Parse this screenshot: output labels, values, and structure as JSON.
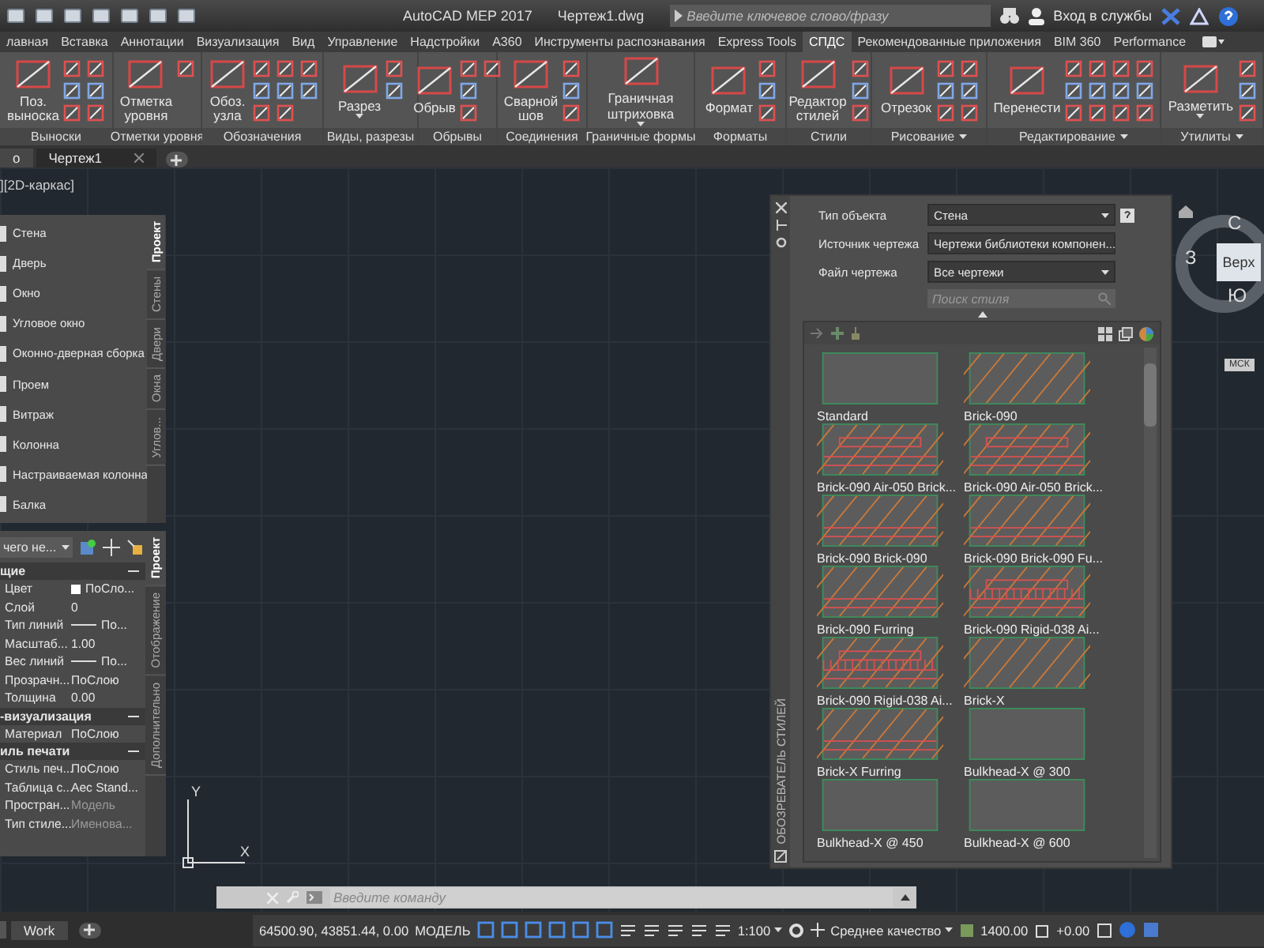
{
  "title_bar": {
    "app": "AutoCAD MEP 2017",
    "file": "Чертеж1.dwg",
    "search": {
      "placeholder": "Введите ключевое слово/фразу"
    },
    "sign_in": "Вход в службы"
  },
  "ribbon": {
    "tabs": [
      {
        "label": "лавная",
        "selected": false
      },
      {
        "label": "Вставка",
        "selected": false
      },
      {
        "label": "Аннотации",
        "selected": false
      },
      {
        "label": "Визуализация",
        "selected": false
      },
      {
        "label": "Вид",
        "selected": false
      },
      {
        "label": "Управление",
        "selected": false
      },
      {
        "label": "Надстройки",
        "selected": false
      },
      {
        "label": "А360",
        "selected": false
      },
      {
        "label": "Инструменты распознавания",
        "selected": false
      },
      {
        "label": "Express Tools",
        "selected": false
      },
      {
        "label": "СПДС",
        "selected": true
      },
      {
        "label": "Рекомендованные приложения",
        "selected": false
      },
      {
        "label": "BIM 360",
        "selected": false
      },
      {
        "label": "Performance",
        "selected": false
      }
    ],
    "panels": [
      {
        "title": "Выноски",
        "expandable": false,
        "buttons": [
          {
            "label": "Поз.\nвыноска",
            "dropdown": false
          }
        ]
      },
      {
        "title": "Отметки уровня",
        "expandable": false,
        "buttons": [
          {
            "label": "Отметка\nуровня",
            "dropdown": false
          }
        ]
      },
      {
        "title": "Обозначения",
        "expandable": false,
        "buttons": [
          {
            "label": "Обоз.\nузла",
            "dropdown": false
          }
        ]
      },
      {
        "title": "Виды, разрезы",
        "expandable": false,
        "buttons": [
          {
            "label": "Разрез",
            "dropdown": true
          }
        ]
      },
      {
        "title": "Обрывы",
        "expandable": false,
        "buttons": [
          {
            "label": "Обрыв",
            "dropdown": false
          }
        ]
      },
      {
        "title": "Соединения",
        "expandable": false,
        "buttons": [
          {
            "label": "Сварной\nшов",
            "dropdown": false
          }
        ]
      },
      {
        "title": "Граничные формы",
        "expandable": false,
        "buttons": [
          {
            "label": "Граничная\nштриховка",
            "dropdown": true
          }
        ]
      },
      {
        "title": "Форматы",
        "expandable": false,
        "buttons": [
          {
            "label": "Формат",
            "dropdown": false
          }
        ]
      },
      {
        "title": "Стили",
        "expandable": false,
        "buttons": [
          {
            "label": "Редактор\nстилей",
            "dropdown": false
          }
        ]
      },
      {
        "title": "Рисование",
        "expandable": true,
        "buttons": [
          {
            "label": "Отрезок",
            "dropdown": false
          }
        ]
      },
      {
        "title": "Редактирование",
        "expandable": true,
        "buttons": [
          {
            "label": "Перенести",
            "dropdown": false
          }
        ]
      },
      {
        "title": "Утилиты",
        "expandable": true,
        "buttons": [
          {
            "label": "Разметить",
            "dropdown": true
          }
        ]
      }
    ]
  },
  "doc_tabs": [
    {
      "label": "о",
      "selected": false
    },
    {
      "label": "Чертеж1",
      "selected": true
    }
  ],
  "viewport_label": "][2D-каркас]",
  "tool_palette": {
    "items": [
      {
        "label": "Стена"
      },
      {
        "label": "Дверь"
      },
      {
        "label": "Окно"
      },
      {
        "label": "Угловое окно"
      },
      {
        "label": "Оконно-дверная сборка"
      },
      {
        "label": "Проем"
      },
      {
        "label": "Витраж"
      },
      {
        "label": "Колонна"
      },
      {
        "label": "Настраиваемая колонна"
      },
      {
        "label": "Балка"
      }
    ],
    "tabs": [
      {
        "label": "Проект",
        "selected": true
      },
      {
        "label": "Стены",
        "selected": false
      },
      {
        "label": "Двери",
        "selected": false
      },
      {
        "label": "Окна",
        "selected": false
      },
      {
        "label": "Углов...",
        "selected": false
      }
    ]
  },
  "properties": {
    "selector": "чего не...",
    "sections": [
      {
        "title": "щие",
        "expanded": true,
        "rows": [
          {
            "name": "Цвет",
            "value": "ПоСло...",
            "kind": "color",
            "disabled": false
          },
          {
            "name": "Слой",
            "value": "0",
            "kind": "text",
            "disabled": false
          },
          {
            "name": "Тип линий",
            "value": "По...",
            "kind": "line",
            "disabled": false
          },
          {
            "name": "Масштаб...",
            "value": "1.00",
            "kind": "text",
            "disabled": false
          },
          {
            "name": "Вес линий",
            "value": "По...",
            "kind": "line",
            "disabled": false
          },
          {
            "name": "Прозрачн...",
            "value": "ПоСлою",
            "kind": "text",
            "disabled": false
          },
          {
            "name": "Толщина",
            "value": "0.00",
            "kind": "text",
            "disabled": false
          }
        ]
      },
      {
        "title": "-визуализация",
        "expanded": true,
        "rows": [
          {
            "name": "Материал",
            "value": "ПоСлою",
            "kind": "text",
            "disabled": false
          }
        ]
      },
      {
        "title": "иль печати",
        "expanded": true,
        "rows": [
          {
            "name": "Стиль печ...",
            "value": "ПоСлою",
            "kind": "text",
            "disabled": false
          },
          {
            "name": "Таблица с...",
            "value": "Aec Stand...",
            "kind": "text",
            "disabled": false
          },
          {
            "name": "Простран...",
            "value": "Модель",
            "kind": "text",
            "disabled": true
          },
          {
            "name": "Тип стиле...",
            "value": "Именова...",
            "kind": "text",
            "disabled": true
          }
        ]
      }
    ],
    "tabs": [
      {
        "label": "Проект",
        "selected": true
      },
      {
        "label": "Отображение",
        "selected": false
      },
      {
        "label": "Дополнительно",
        "selected": false
      }
    ]
  },
  "style_browser": {
    "title": "ОБОЗРЕВАТЕЛЬ СТИЛЕЙ",
    "fields": [
      {
        "label": "Тип объекта",
        "value": "Стена"
      },
      {
        "label": "Источник чертежа",
        "value": "Чертежи библиотеки компонен..."
      },
      {
        "label": "Файл чертежа",
        "value": "Все чертежи"
      }
    ],
    "search": {
      "placeholder": "Поиск стиля"
    },
    "styles": [
      {
        "name": "Standard",
        "kind": "empty"
      },
      {
        "name": "Brick-090",
        "kind": "hatch"
      },
      {
        "name": "Brick-090 Air-050 Brick...",
        "kind": "band"
      },
      {
        "name": "Brick-090 Air-050 Brick...",
        "kind": "band"
      },
      {
        "name": "Brick-090 Brick-090",
        "kind": "lines"
      },
      {
        "name": "Brick-090 Brick-090 Fu...",
        "kind": "lines"
      },
      {
        "name": "Brick-090 Furring",
        "kind": "lines"
      },
      {
        "name": "Brick-090 Rigid-038 Ai...",
        "kind": "rigid"
      },
      {
        "name": "Brick-090 Rigid-038 Ai...",
        "kind": "rigid"
      },
      {
        "name": "Brick-X",
        "kind": "hatch"
      },
      {
        "name": "Brick-X Furring",
        "kind": "lines"
      },
      {
        "name": "Bulkhead-X @ 300",
        "kind": "empty"
      },
      {
        "name": "Bulkhead-X @ 450",
        "kind": "empty"
      },
      {
        "name": "Bulkhead-X @ 600",
        "kind": "empty"
      }
    ]
  },
  "view_cube": {
    "north": "С",
    "west": "З",
    "face": "Верх",
    "south": "Ю",
    "ucs": "МСК"
  },
  "ucs_icon": {
    "x": "X",
    "y": "Y"
  },
  "command_line": {
    "placeholder": "Введите команду"
  },
  "layout_tabs": [
    {
      "label": "Work"
    }
  ],
  "status_bar": {
    "coordinates": "64500.90, 43851.44, 0.00",
    "space": "МОДЕЛЬ",
    "scale": "1:100",
    "quality": "Среднее качество",
    "elevation": "1400.00",
    "offset": "+0.00"
  }
}
